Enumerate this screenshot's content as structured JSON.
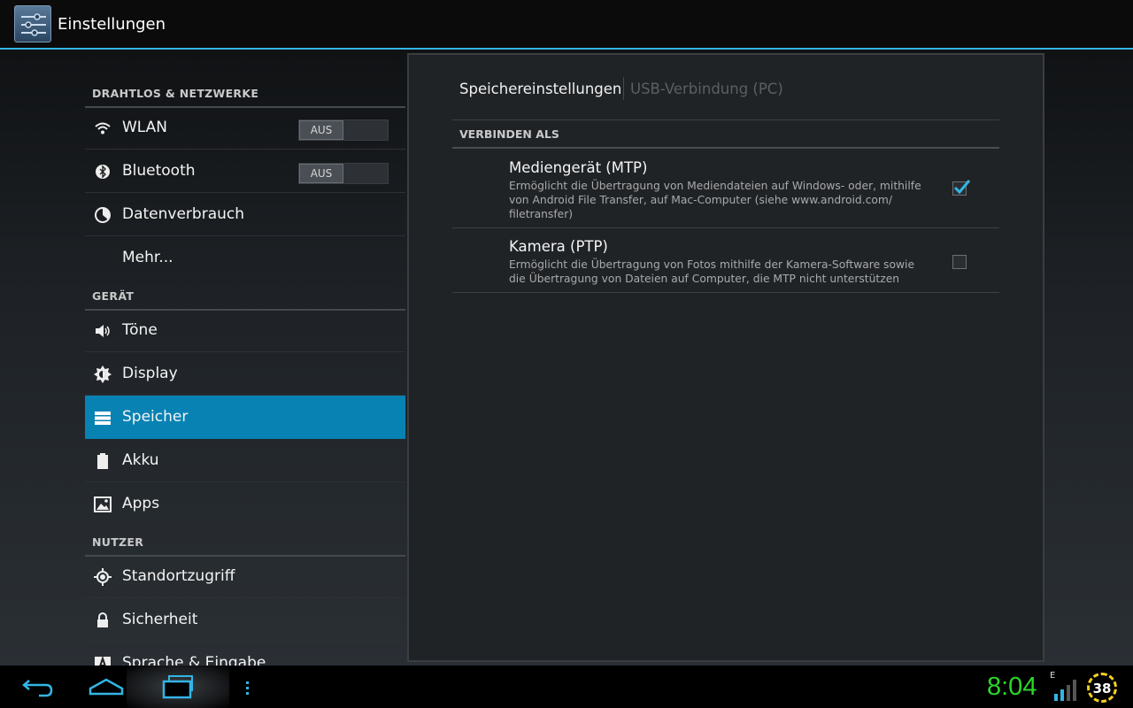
{
  "app": {
    "title": "Einstellungen"
  },
  "sidebar": {
    "sections": [
      {
        "header": "DRAHTLOS & NETZWERKE"
      },
      {
        "header": "GERÄT"
      },
      {
        "header": "NUTZER"
      }
    ],
    "items": [
      {
        "label": "WLAN",
        "icon": "wifi-icon",
        "toggle": "AUS"
      },
      {
        "label": "Bluetooth",
        "icon": "bluetooth-icon",
        "toggle": "AUS"
      },
      {
        "label": "Datenverbrauch",
        "icon": "data-usage-icon"
      },
      {
        "label": "Mehr..."
      },
      {
        "label": "Töne",
        "icon": "speaker-icon"
      },
      {
        "label": "Display",
        "icon": "brightness-icon"
      },
      {
        "label": "Speicher",
        "icon": "storage-icon",
        "selected": true
      },
      {
        "label": "Akku",
        "icon": "battery-icon"
      },
      {
        "label": "Apps",
        "icon": "apps-icon"
      },
      {
        "label": "Standortzugriff",
        "icon": "location-icon"
      },
      {
        "label": "Sicherheit",
        "icon": "lock-icon"
      },
      {
        "label": "Sprache & Eingabe",
        "icon": "language-icon"
      }
    ]
  },
  "panel": {
    "tabs": [
      {
        "label": "Speichereinstellungen",
        "active": true
      },
      {
        "label": "USB-Verbindung (PC)",
        "active": false
      }
    ],
    "section_header": "VERBINDEN ALS",
    "options": [
      {
        "title": "Mediengerät (MTP)",
        "desc_lines": [
          "Ermöglicht die Übertragung von Mediendateien auf Windows- oder, mithilfe",
          "von Android File Transfer, auf Mac-Computer (siehe www.android.com/",
          "filetransfer)"
        ],
        "checked": true
      },
      {
        "title": "Kamera (PTP)",
        "desc_lines": [
          "Ermöglicht die Übertragung von Fotos mithilfe der Kamera-Software sowie",
          "die Übertragung von Dateien auf Computer, die MTP nicht unterstützen"
        ],
        "checked": false
      }
    ]
  },
  "statusbar": {
    "time": "8:04",
    "network": "E",
    "battery": "38"
  },
  "colors": {
    "accent": "#33b5e5",
    "selected": "#0882b3",
    "clock": "#2bd62b"
  }
}
